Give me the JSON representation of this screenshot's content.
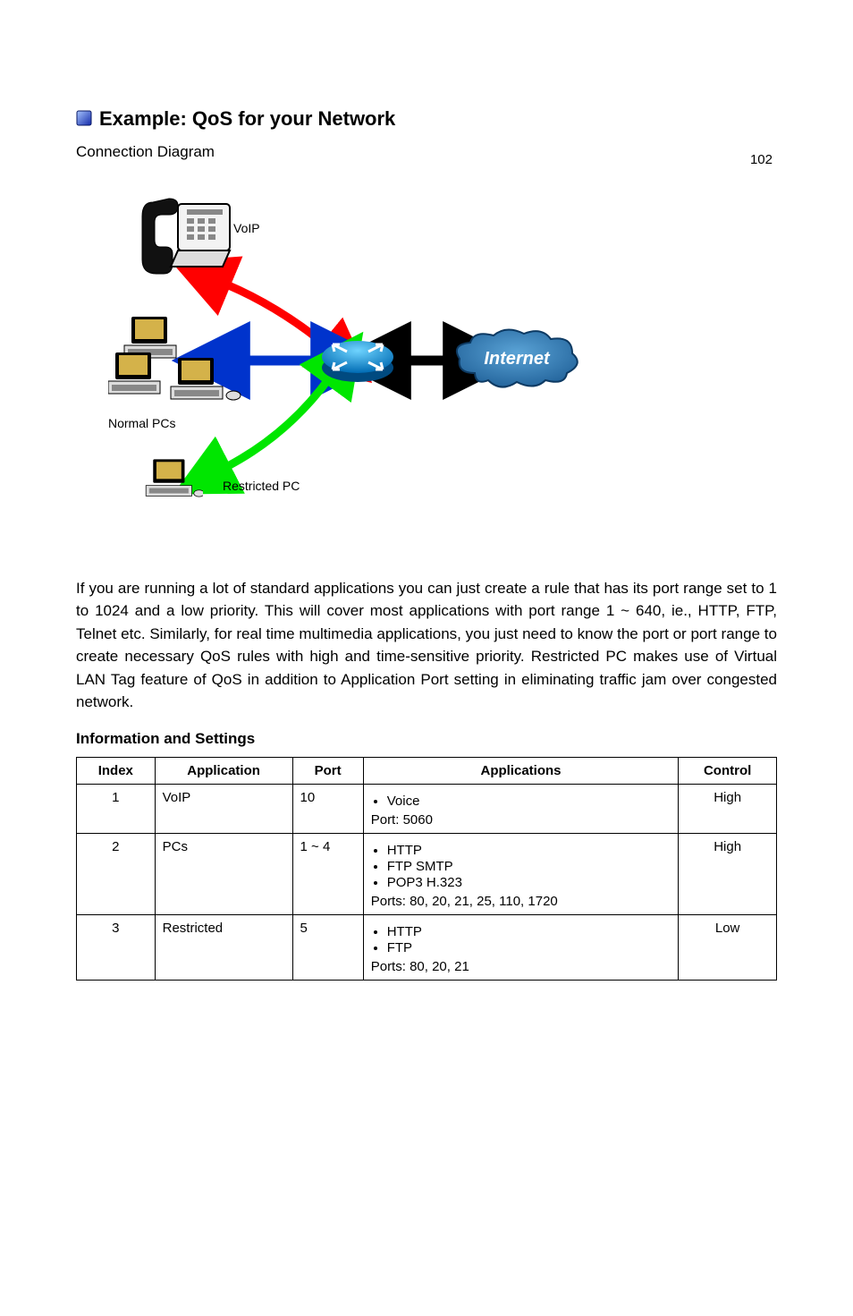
{
  "page_number": "102",
  "section": {
    "heading": "Example: QoS for your Network",
    "intro": "Connection Diagram",
    "phone_label": "VoIP",
    "cluster_label": "Normal PCs",
    "single_pc_label": "Restricted PC",
    "internet_label": "Internet",
    "description": "If you are running a lot of standard applications you can just create a rule that has its port range set to 1 to 1024 and a low priority. This will cover most applications with port range 1 ~ 640, ie., HTTP, FTP, Telnet etc. Similarly, for real time multimedia applications, you just need to know the port or port range to create necessary QoS rules with high and time-sensitive priority. Restricted PC makes use of Virtual LAN Tag feature of QoS in addition to Application Port setting in eliminating traffic jam over congested network.",
    "info_title": "Information and Settings"
  },
  "table": {
    "headers": [
      "Index",
      "Application",
      "Port",
      "Applications",
      "Control"
    ],
    "rows": [
      {
        "index": "1",
        "application": "VoIP",
        "port": "10",
        "apps": [
          "Voice"
        ],
        "ports_range": "Port: 5060",
        "control": "High"
      },
      {
        "index": "2",
        "application": "PCs",
        "port": "1 ~ 4",
        "apps": [
          "HTTP",
          "FTP SMTP",
          "POP3 H.323"
        ],
        "ports_range": "Ports: 80, 20, 21, 25, 110, 1720",
        "control": "High"
      },
      {
        "index": "3",
        "application": "Restricted",
        "port": "5",
        "apps": [
          "HTTP",
          "FTP"
        ],
        "ports_range": "Ports: 80, 20, 21",
        "control": "Low"
      }
    ]
  }
}
